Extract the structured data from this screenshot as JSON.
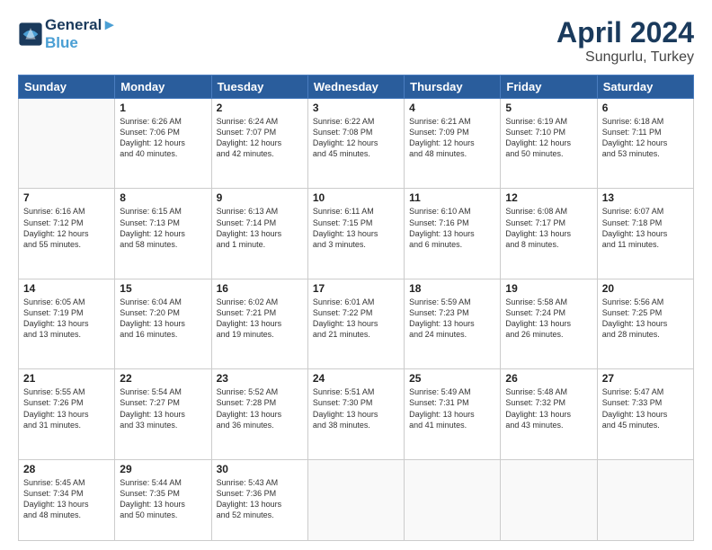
{
  "logo": {
    "line1": "General",
    "line2": "Blue"
  },
  "title": "April 2024",
  "subtitle": "Sungurlu, Turkey",
  "headers": [
    "Sunday",
    "Monday",
    "Tuesday",
    "Wednesday",
    "Thursday",
    "Friday",
    "Saturday"
  ],
  "weeks": [
    [
      {
        "num": "",
        "info": ""
      },
      {
        "num": "1",
        "info": "Sunrise: 6:26 AM\nSunset: 7:06 PM\nDaylight: 12 hours\nand 40 minutes."
      },
      {
        "num": "2",
        "info": "Sunrise: 6:24 AM\nSunset: 7:07 PM\nDaylight: 12 hours\nand 42 minutes."
      },
      {
        "num": "3",
        "info": "Sunrise: 6:22 AM\nSunset: 7:08 PM\nDaylight: 12 hours\nand 45 minutes."
      },
      {
        "num": "4",
        "info": "Sunrise: 6:21 AM\nSunset: 7:09 PM\nDaylight: 12 hours\nand 48 minutes."
      },
      {
        "num": "5",
        "info": "Sunrise: 6:19 AM\nSunset: 7:10 PM\nDaylight: 12 hours\nand 50 minutes."
      },
      {
        "num": "6",
        "info": "Sunrise: 6:18 AM\nSunset: 7:11 PM\nDaylight: 12 hours\nand 53 minutes."
      }
    ],
    [
      {
        "num": "7",
        "info": "Sunrise: 6:16 AM\nSunset: 7:12 PM\nDaylight: 12 hours\nand 55 minutes."
      },
      {
        "num": "8",
        "info": "Sunrise: 6:15 AM\nSunset: 7:13 PM\nDaylight: 12 hours\nand 58 minutes."
      },
      {
        "num": "9",
        "info": "Sunrise: 6:13 AM\nSunset: 7:14 PM\nDaylight: 13 hours\nand 1 minute."
      },
      {
        "num": "10",
        "info": "Sunrise: 6:11 AM\nSunset: 7:15 PM\nDaylight: 13 hours\nand 3 minutes."
      },
      {
        "num": "11",
        "info": "Sunrise: 6:10 AM\nSunset: 7:16 PM\nDaylight: 13 hours\nand 6 minutes."
      },
      {
        "num": "12",
        "info": "Sunrise: 6:08 AM\nSunset: 7:17 PM\nDaylight: 13 hours\nand 8 minutes."
      },
      {
        "num": "13",
        "info": "Sunrise: 6:07 AM\nSunset: 7:18 PM\nDaylight: 13 hours\nand 11 minutes."
      }
    ],
    [
      {
        "num": "14",
        "info": "Sunrise: 6:05 AM\nSunset: 7:19 PM\nDaylight: 13 hours\nand 13 minutes."
      },
      {
        "num": "15",
        "info": "Sunrise: 6:04 AM\nSunset: 7:20 PM\nDaylight: 13 hours\nand 16 minutes."
      },
      {
        "num": "16",
        "info": "Sunrise: 6:02 AM\nSunset: 7:21 PM\nDaylight: 13 hours\nand 19 minutes."
      },
      {
        "num": "17",
        "info": "Sunrise: 6:01 AM\nSunset: 7:22 PM\nDaylight: 13 hours\nand 21 minutes."
      },
      {
        "num": "18",
        "info": "Sunrise: 5:59 AM\nSunset: 7:23 PM\nDaylight: 13 hours\nand 24 minutes."
      },
      {
        "num": "19",
        "info": "Sunrise: 5:58 AM\nSunset: 7:24 PM\nDaylight: 13 hours\nand 26 minutes."
      },
      {
        "num": "20",
        "info": "Sunrise: 5:56 AM\nSunset: 7:25 PM\nDaylight: 13 hours\nand 28 minutes."
      }
    ],
    [
      {
        "num": "21",
        "info": "Sunrise: 5:55 AM\nSunset: 7:26 PM\nDaylight: 13 hours\nand 31 minutes."
      },
      {
        "num": "22",
        "info": "Sunrise: 5:54 AM\nSunset: 7:27 PM\nDaylight: 13 hours\nand 33 minutes."
      },
      {
        "num": "23",
        "info": "Sunrise: 5:52 AM\nSunset: 7:28 PM\nDaylight: 13 hours\nand 36 minutes."
      },
      {
        "num": "24",
        "info": "Sunrise: 5:51 AM\nSunset: 7:30 PM\nDaylight: 13 hours\nand 38 minutes."
      },
      {
        "num": "25",
        "info": "Sunrise: 5:49 AM\nSunset: 7:31 PM\nDaylight: 13 hours\nand 41 minutes."
      },
      {
        "num": "26",
        "info": "Sunrise: 5:48 AM\nSunset: 7:32 PM\nDaylight: 13 hours\nand 43 minutes."
      },
      {
        "num": "27",
        "info": "Sunrise: 5:47 AM\nSunset: 7:33 PM\nDaylight: 13 hours\nand 45 minutes."
      }
    ],
    [
      {
        "num": "28",
        "info": "Sunrise: 5:45 AM\nSunset: 7:34 PM\nDaylight: 13 hours\nand 48 minutes."
      },
      {
        "num": "29",
        "info": "Sunrise: 5:44 AM\nSunset: 7:35 PM\nDaylight: 13 hours\nand 50 minutes."
      },
      {
        "num": "30",
        "info": "Sunrise: 5:43 AM\nSunset: 7:36 PM\nDaylight: 13 hours\nand 52 minutes."
      },
      {
        "num": "",
        "info": ""
      },
      {
        "num": "",
        "info": ""
      },
      {
        "num": "",
        "info": ""
      },
      {
        "num": "",
        "info": ""
      }
    ]
  ]
}
